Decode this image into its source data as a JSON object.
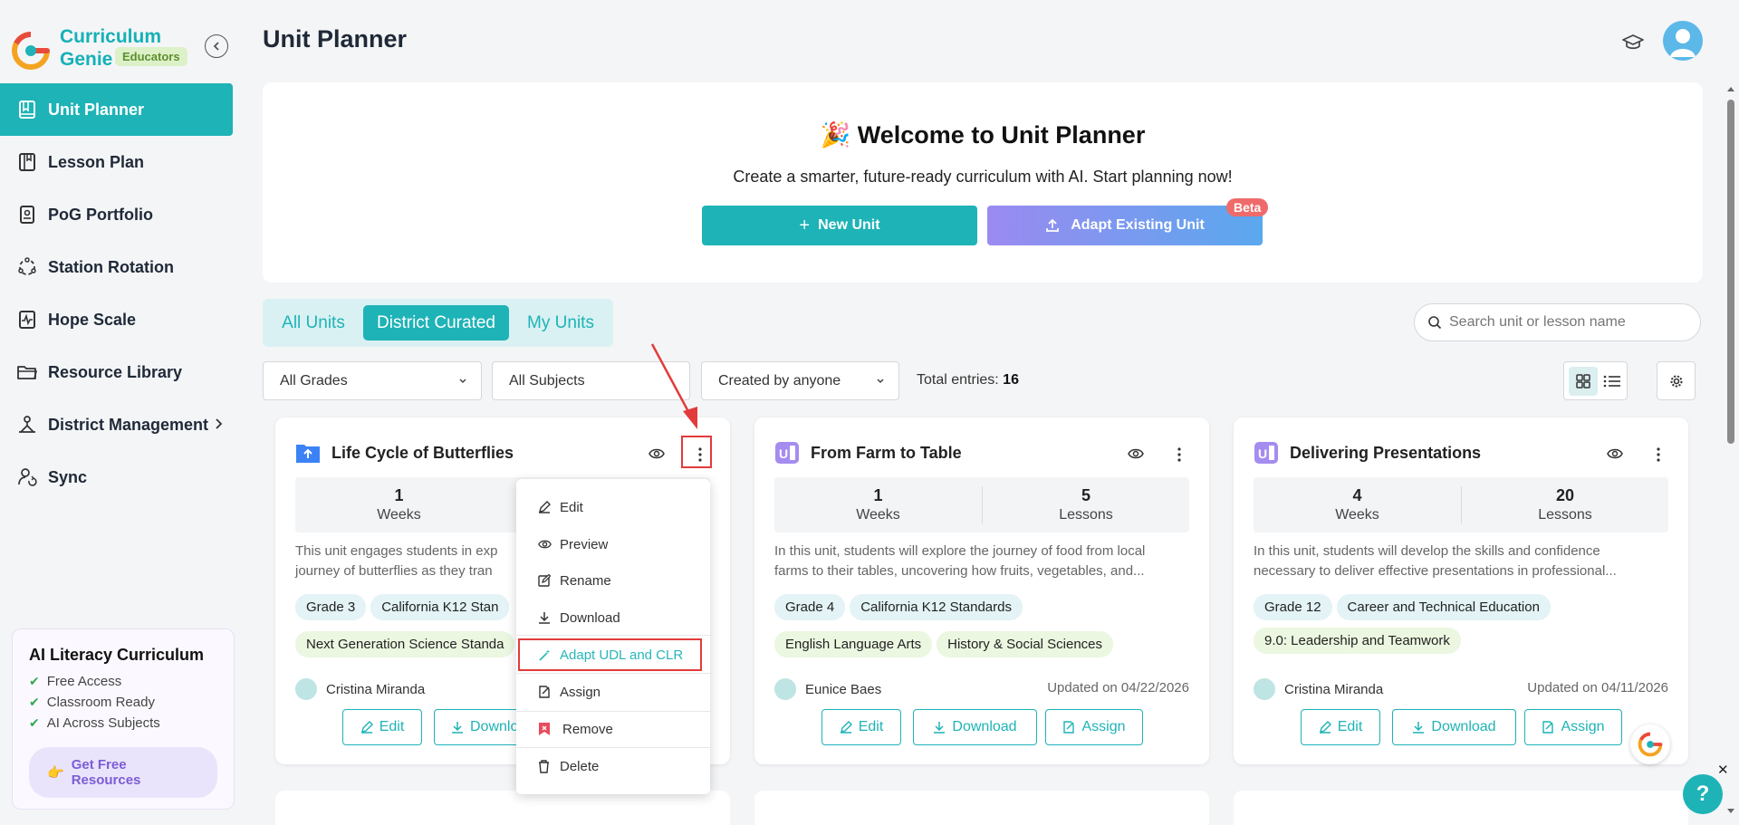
{
  "brand": {
    "line1": "Curriculum",
    "line2": "Genie",
    "badge": "Educators"
  },
  "sidebar": {
    "items": [
      {
        "label": "Unit Planner",
        "icon": "book-icon",
        "active": true
      },
      {
        "label": "Lesson Plan",
        "icon": "notebook-icon"
      },
      {
        "label": "PoG Portfolio",
        "icon": "portfolio-icon"
      },
      {
        "label": "Station Rotation",
        "icon": "rotation-icon"
      },
      {
        "label": "Hope Scale",
        "icon": "pulse-icon"
      },
      {
        "label": "Resource Library",
        "icon": "folder-icon"
      },
      {
        "label": "District Management",
        "icon": "district-icon"
      },
      {
        "label": "Sync",
        "icon": "user-sync-icon"
      }
    ]
  },
  "promo": {
    "title": "AI Literacy Curriculum",
    "items": [
      "Free Access",
      "Classroom Ready",
      "AI Across Subjects"
    ],
    "button": "Get Free Resources"
  },
  "header": {
    "title": "Unit Planner"
  },
  "welcome": {
    "title": "Welcome to Unit Planner",
    "subtitle": "Create a smarter, future-ready curriculum with AI. Start planning now!",
    "new_unit": "New Unit",
    "adapt_unit": "Adapt Existing Unit",
    "beta": "Beta"
  },
  "tabs": [
    "All Units",
    "District Curated",
    "My Units"
  ],
  "search": {
    "placeholder": "Search unit or lesson name"
  },
  "filters": {
    "grades": "All Grades",
    "subjects": "All Subjects",
    "creator": "Created by anyone",
    "total_label": "Total entries:",
    "total_value": "16"
  },
  "cards": [
    {
      "title": "Life Cycle of Butterflies",
      "weeks": "1",
      "weeks_label": "Weeks",
      "lessons": "",
      "lessons_label": "",
      "description": "This unit engages students in exp... journey of butterflies as they tran...",
      "desc1": "This unit engages students in exp",
      "desc2": "journey of butterflies as they tran",
      "tags_blue": [
        "Grade 3",
        "California K12 Stan"
      ],
      "tags_green": [
        "Next Generation Science Standa"
      ],
      "author": "Cristina Miranda",
      "updated": "",
      "btn_edit": "Edit",
      "btn_download": "Downlo"
    },
    {
      "title": "From Farm to Table",
      "weeks": "1",
      "weeks_label": "Weeks",
      "lessons": "5",
      "lessons_label": "Lessons",
      "desc1": "In this unit, students will explore the journey of food from local",
      "desc2": "farms to their tables, uncovering how fruits, vegetables, and...",
      "tags_blue": [
        "Grade 4",
        "California K12 Standards"
      ],
      "tags_green": [
        "English Language Arts",
        "History & Social Sciences"
      ],
      "author": "Eunice Baes",
      "updated": "Updated on 04/22/2026",
      "btn_edit": "Edit",
      "btn_download": "Download",
      "btn_assign": "Assign"
    },
    {
      "title": "Delivering Presentations",
      "weeks": "4",
      "weeks_label": "Weeks",
      "lessons": "20",
      "lessons_label": "Lessons",
      "desc1": "In this unit, students will develop the skills and confidence",
      "desc2": "necessary to deliver effective presentations in professional...",
      "tags_blue": [
        "Grade 12",
        "Career and Technical Education"
      ],
      "tags_green": [
        "9.0: Leadership and Teamwork"
      ],
      "author": "Cristina Miranda",
      "updated": "Updated on 04/11/2026",
      "btn_edit": "Edit",
      "btn_download": "Download",
      "btn_assign": "Assign"
    }
  ],
  "menu": [
    "Edit",
    "Preview",
    "Rename",
    "Download",
    "Adapt UDL and CLR",
    "Assign",
    "Remove",
    "Delete"
  ],
  "colors": {
    "accent": "#1eb3b7",
    "highlight": "#e23b3b",
    "adapt_gradient_start": "#9b8af1",
    "adapt_gradient_end": "#5aa8ee"
  }
}
